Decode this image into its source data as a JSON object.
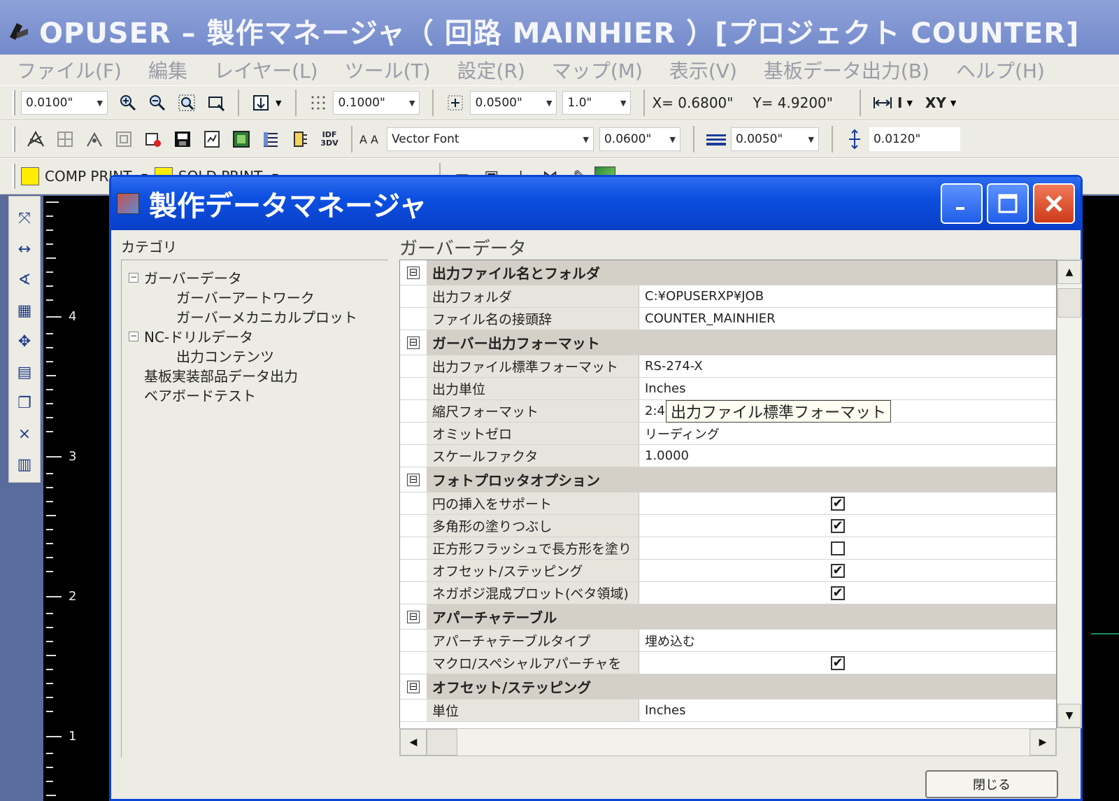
{
  "app": {
    "title": "OPUSER – 製作マネージャ（ 回路 MAINHIER ）[プロジェクト COUNTER]"
  },
  "menu": [
    {
      "label": "ファイル(F)"
    },
    {
      "label": "編集"
    },
    {
      "label": "レイヤー(L)"
    },
    {
      "label": "ツール(T)"
    },
    {
      "label": "設定(R)"
    },
    {
      "label": "マップ(M)"
    },
    {
      "label": "表示(V)"
    },
    {
      "label": "基板データ出力(B)"
    },
    {
      "label": "ヘルプ(H)"
    }
  ],
  "toolbar1": {
    "snap_value": "0.0100\"",
    "grid_value": "0.1000\"",
    "step_value": "0.0500\"",
    "ratio_value": "1.0\"",
    "x_readout": "X= 0.6800\"",
    "y_readout": "Y= 4.9200\"",
    "mode_i": "I",
    "mode_xy": "XY"
  },
  "toolbar2": {
    "idf_label": "IDF\n3DV",
    "font_label": "A A",
    "font_value": "Vector Font",
    "text_size": "0.0600\"",
    "line_width": "0.0050\"",
    "spacing": "0.0120\""
  },
  "toolbar3": {
    "layer1": "COMP PRINT",
    "layer2": "SOLD PRINT"
  },
  "ruler": {
    "labels": [
      "4",
      "3",
      "2",
      "1"
    ]
  },
  "dialog": {
    "title": "製作データマネージャ",
    "category_label": "カテゴリ",
    "panel_label": "ガーバーデータ",
    "tree": [
      {
        "label": "ガーバーデータ",
        "toggle": "−"
      },
      {
        "label": "ガーバーアートワーク"
      },
      {
        "label": "ガーバーメカニカルプロット"
      },
      {
        "label": "NC-ドリルデータ",
        "toggle": "−"
      },
      {
        "label": "出力コンテンツ"
      },
      {
        "label": "基板実装部品データ出力"
      },
      {
        "label": "ベアボードテスト"
      }
    ],
    "grid": {
      "sec1": {
        "title": "出力ファイル名とフォルダ",
        "toggle": "⊟"
      },
      "r_out_folder": {
        "name": "出力フォルダ",
        "value": "C:¥OPUSERXP¥JOB"
      },
      "r_file_prefix": {
        "name": "ファイル名の接頭辞",
        "value": "COUNTER_MAINHIER"
      },
      "sec2": {
        "title": "ガーバー出力フォーマット",
        "toggle": "⊟"
      },
      "r_std_format": {
        "name": "出力ファイル標準フォーマット",
        "value": "RS-274-X"
      },
      "r_unit": {
        "name": "出力単位",
        "value": "Inches"
      },
      "r_scale_format": {
        "name": "縮尺フォーマット",
        "value": "2:4"
      },
      "tooltip": "出力ファイル標準フォーマット",
      "r_omit_zero": {
        "name": "オミットゼロ",
        "value": "リーディング"
      },
      "r_scale_factor": {
        "name": "スケールファクタ",
        "value": "1.0000"
      },
      "sec3": {
        "title": "フォトプロッタオプション",
        "toggle": "⊟"
      },
      "r_circle": {
        "name": "円の挿入をサポート",
        "checked": true
      },
      "r_polyfill": {
        "name": "多角形の塗りつぶし",
        "checked": true
      },
      "r_square_flash": {
        "name": "正方形フラッシュで長方形を塗り",
        "checked": false
      },
      "r_offset": {
        "name": "オフセット/ステッピング",
        "checked": true
      },
      "r_negpos": {
        "name": "ネガポジ混成プロット(ベタ領域)",
        "checked": true
      },
      "sec4": {
        "title": "アパーチャテーブル",
        "toggle": "⊟"
      },
      "r_ap_type": {
        "name": "アパーチャテーブルタイプ",
        "value": "埋め込む"
      },
      "r_macro": {
        "name": "マクロ/スペシャルアパーチャを",
        "checked": true
      },
      "sec5": {
        "title": "オフセット/ステッピング",
        "toggle": "⊟"
      },
      "r_unit2": {
        "name": "単位",
        "value": "Inches"
      }
    },
    "close_label": "閉じる",
    "check_mark": "✔"
  },
  "colors": {
    "titlebar": "#0a46d6",
    "close_button": "#cf3a18",
    "layer_swatch": "#ffee00"
  }
}
